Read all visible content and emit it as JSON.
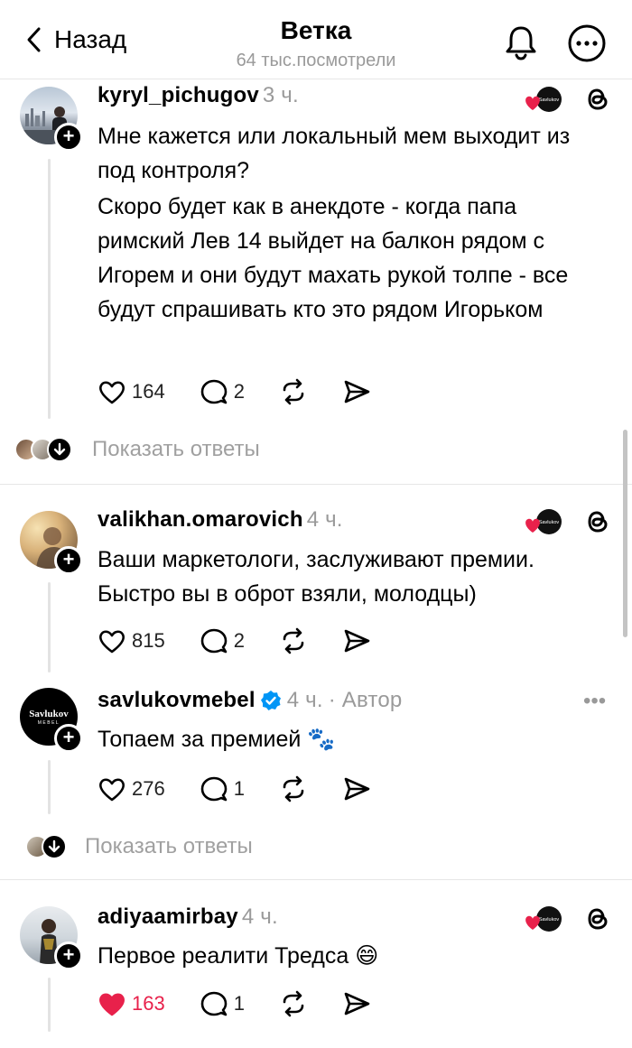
{
  "header": {
    "back_label": "Назад",
    "title": "Ветка",
    "subtitle": "64 тыс.посмотрели"
  },
  "posts": [
    {
      "username": "kyryl_pichugov",
      "time": "3 ч.",
      "paragraphs": [
        "Мне кажется или локальный мем выходит из под контроля?",
        "Скоро будет как в анекдоте - когда папа римский Лев 14 выйдет на балкон рядом с Игорем и они будут махать рукой толпе - все будут спрашивать кто это рядом Игорьком"
      ],
      "likes": "164",
      "replies": "2"
    },
    {
      "username": "valikhan.omarovich",
      "time": "4 ч.",
      "paragraphs": [
        "Ваши маркетологи, заслуживают премии. Быстро вы в оброт взяли, молодцы)"
      ],
      "likes": "815",
      "replies": "2"
    },
    {
      "username": "savlukovmebel",
      "time": "4 ч.",
      "author_tag": "· Автор",
      "avatar_text": "Savlukov",
      "avatar_subtext": "MEBEL",
      "paragraphs": [
        "Топаем за премией 🐾"
      ],
      "likes": "276",
      "replies": "1"
    },
    {
      "username": "adiyaamirbay",
      "time": "4 ч.",
      "paragraphs": [
        "Первое реалити Тредса 😄"
      ],
      "likes": "163",
      "replies": "1"
    }
  ],
  "show_replies_label": "Показать ответы",
  "colors": {
    "like_active": "#e8214b",
    "muted_text": "#9a9a9a",
    "verified": "#0095f6"
  }
}
